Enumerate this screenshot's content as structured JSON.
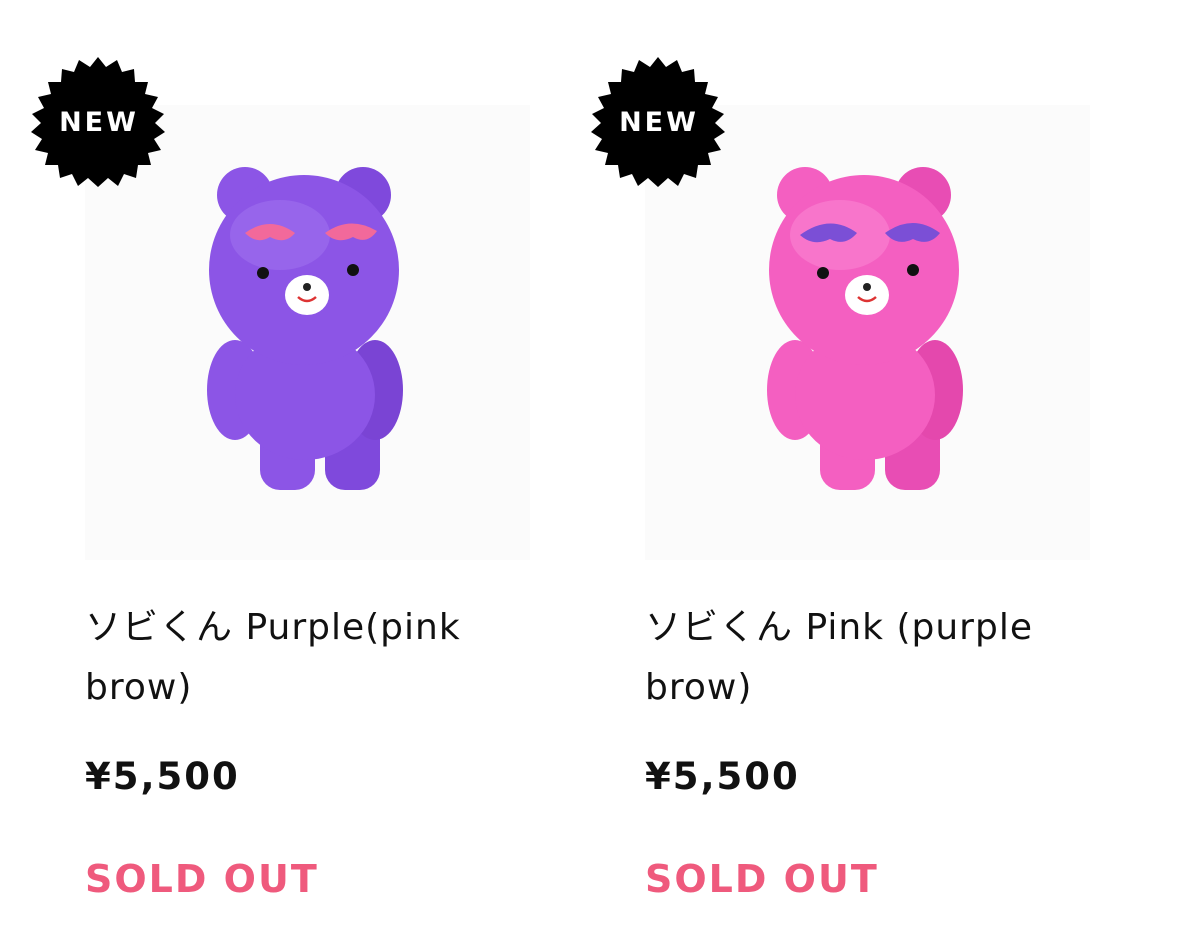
{
  "products": [
    {
      "badge": "NEW",
      "title": "ソビくん Purple(pink brow)",
      "price": "¥5,500",
      "status": "SOLD OUT",
      "image_alt": "purple bear figure with pink brows",
      "colors": {
        "body": "#8c55e6",
        "body_shade": "#6e3ac8",
        "brow": "#f2699b",
        "muzzle": "#ffffff",
        "status": "#ef5a7d"
      }
    },
    {
      "badge": "NEW",
      "title": "ソビくん Pink (purple brow)",
      "price": "¥5,500",
      "status": "SOLD OUT",
      "image_alt": "pink bear figure with purple brows",
      "colors": {
        "body": "#f45fc1",
        "body_shade": "#e03aa6",
        "brow": "#7b4fd6",
        "muzzle": "#ffffff",
        "status": "#ef5a7d"
      }
    }
  ]
}
